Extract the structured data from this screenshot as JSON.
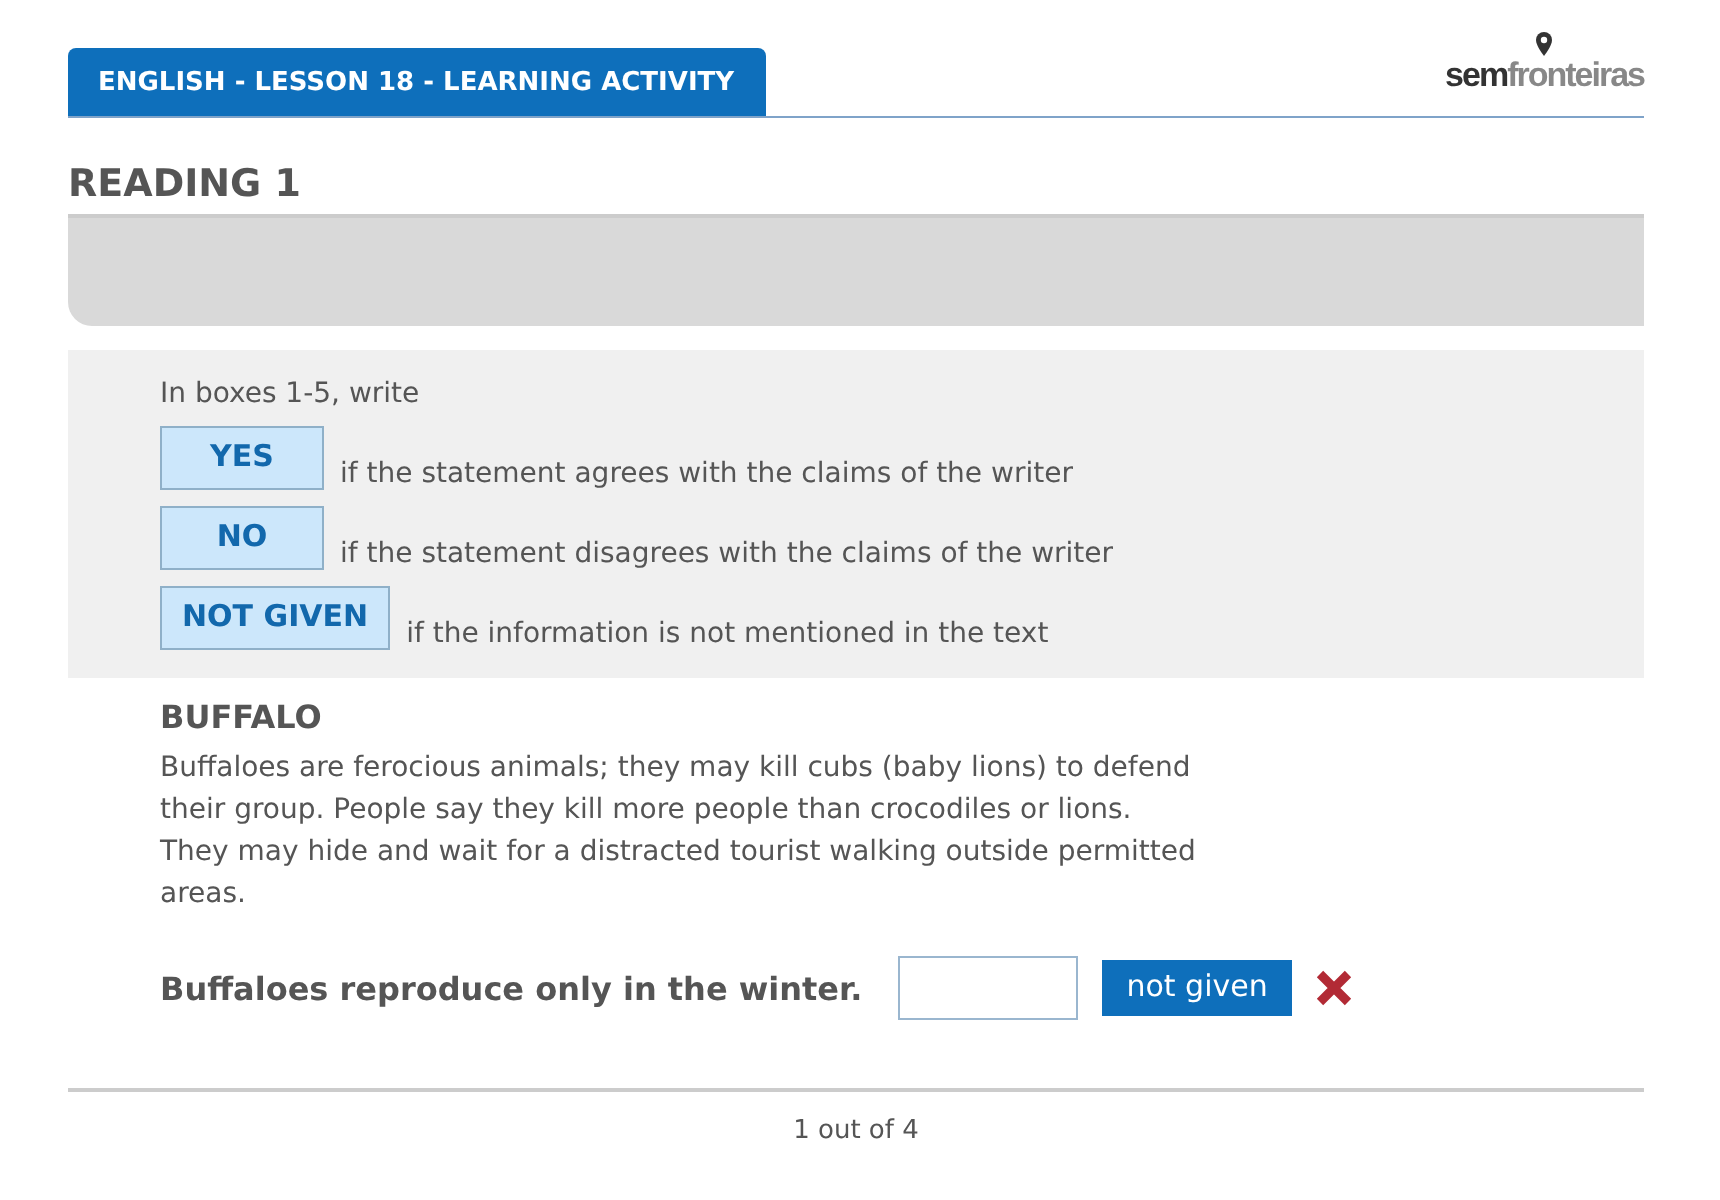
{
  "header": {
    "title": "ENGLISH - LESSON 18 - LEARNING ACTIVITY",
    "logo": "**sem**fronteiras"
  },
  "section_title": "READING 1",
  "instructions": {
    "intro": "In boxes 1-5, write",
    "options": [
      {
        "label": "YES",
        "meaning": "if the statement agrees with the claims of the writer"
      },
      {
        "label": "NO",
        "meaning": "if the statement disagrees with the claims of the writer"
      },
      {
        "label": "NOT GIVEN",
        "meaning": "if the information is not mentioned in the text"
      }
    ]
  },
  "passage": {
    "title": "BUFFALO",
    "text": "Buffaloes are ferocious animals; they may kill cubs (baby lions) to defend their group. People say they kill more people than crocodiles or lions. They may hide and wait for a distracted tourist walking outside permitted areas."
  },
  "question": {
    "statement": "Buffaloes reproduce only in the winter.",
    "answer": "not given",
    "correct": false
  },
  "pager": "1 out of 4"
}
